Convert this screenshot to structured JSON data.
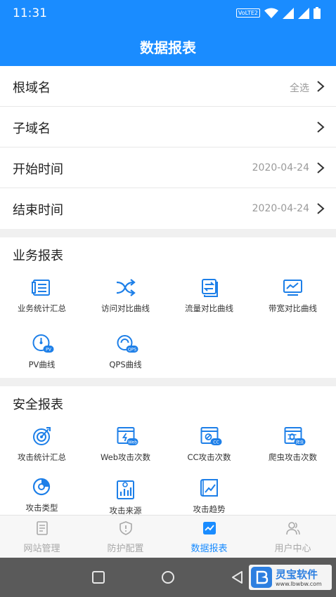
{
  "status_bar": {
    "time": "11:31",
    "volte": "VoLTE2"
  },
  "header": {
    "title": "数据报表"
  },
  "filters": [
    {
      "label": "根域名",
      "value": "全选"
    },
    {
      "label": "子域名",
      "value": ""
    },
    {
      "label": "开始时间",
      "value": "2020-04-24"
    },
    {
      "label": "结束时间",
      "value": "2020-04-24"
    }
  ],
  "business": {
    "title": "业务报表",
    "items": [
      {
        "label": "业务统计汇总",
        "icon": "list-report-icon"
      },
      {
        "label": "访问对比曲线",
        "icon": "shuffle-icon"
      },
      {
        "label": "流量对比曲线",
        "icon": "transfer-icon"
      },
      {
        "label": "带宽对比曲线",
        "icon": "monitor-chart-icon"
      },
      {
        "label": "PV曲线",
        "icon": "pv-gauge-icon",
        "badge": "PV"
      },
      {
        "label": "QPS曲线",
        "icon": "qps-gauge-icon",
        "badge": "QPS"
      }
    ]
  },
  "security": {
    "title": "安全报表",
    "items": [
      {
        "label": "攻击统计汇总",
        "icon": "target-icon"
      },
      {
        "label": "Web攻击次数",
        "icon": "web-attack-icon",
        "badge": "Web"
      },
      {
        "label": "CC攻击次数",
        "icon": "cc-attack-icon",
        "badge": "CC"
      },
      {
        "label": "爬虫攻击次数",
        "icon": "crawler-attack-icon",
        "badge": "爬虫"
      },
      {
        "label": "攻击类型",
        "icon": "pie-chart-icon"
      },
      {
        "label": "攻击来源",
        "icon": "source-chart-icon"
      },
      {
        "label": "攻击趋势",
        "icon": "trend-chart-icon"
      }
    ]
  },
  "tabs": [
    {
      "label": "网站管理",
      "icon": "document-icon",
      "active": false
    },
    {
      "label": "防护配置",
      "icon": "shield-icon",
      "active": false
    },
    {
      "label": "数据报表",
      "icon": "chart-icon",
      "active": true
    },
    {
      "label": "用户中心",
      "icon": "users-icon",
      "active": false
    }
  ],
  "watermark": {
    "title": "灵宝软件",
    "url": "www.lbwbw.com"
  },
  "colors": {
    "primary": "#1a8cff",
    "icon_blue": "#1d7fe8",
    "muted": "#a8a8a8"
  }
}
